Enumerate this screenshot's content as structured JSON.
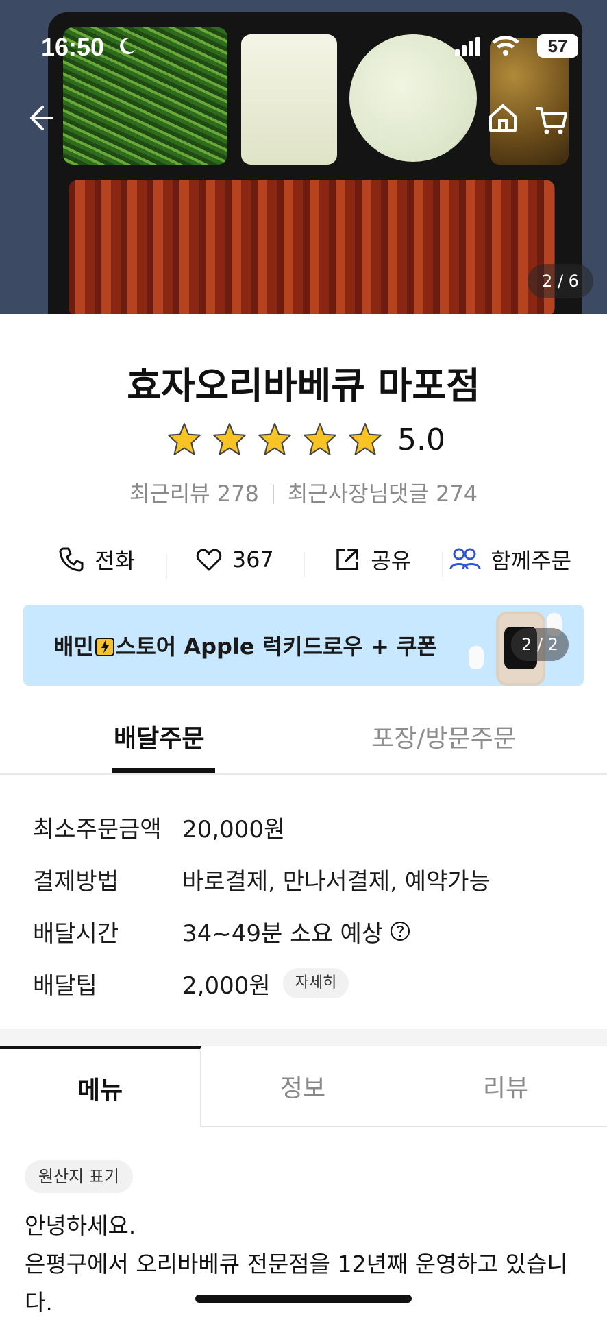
{
  "status_bar": {
    "time": "16:50",
    "battery": "57"
  },
  "hero": {
    "counter": "2 / 6"
  },
  "store": {
    "name": "효자오리바베큐 마포점",
    "rating": "5.0",
    "stars": 5,
    "recent_reviews": "최근리뷰 278",
    "owner_replies": "최근사장님댓글 274"
  },
  "actions": {
    "call": "전화",
    "likes": "367",
    "share": "공유",
    "group_order": "함께주문"
  },
  "banner": {
    "prefix": "배민",
    "text": "스토어 Apple 럭키드로우 + 쿠폰",
    "counter": "2 / 2",
    "bg_color": "#c8e8ff"
  },
  "order_tabs": {
    "delivery": "배달주문",
    "pickup": "포장/방문주문"
  },
  "info": {
    "min_order": {
      "label": "최소주문금액",
      "value": "20,000원"
    },
    "payment": {
      "label": "결제방법",
      "value": "바로결제, 만나서결제, 예약가능"
    },
    "delivery_time": {
      "label": "배달시간",
      "value": "34~49분 소요 예상"
    },
    "delivery_tip": {
      "label": "배달팁",
      "value": "2,000원",
      "detail": "자세히"
    }
  },
  "bottom_tabs": {
    "menu": "메뉴",
    "info": "정보",
    "review": "리뷰"
  },
  "origin_label": "원산지 표기",
  "intro": {
    "line1": "안녕하세요.",
    "line2": "은평구에서 오리바베큐 전문점을 12년째 운영하고 있습니",
    "line3": "다."
  },
  "icons": [
    "back-icon",
    "home-icon",
    "cart-icon",
    "phone-icon",
    "heart-icon",
    "share-icon",
    "group-icon",
    "star-icon",
    "question-icon"
  ]
}
